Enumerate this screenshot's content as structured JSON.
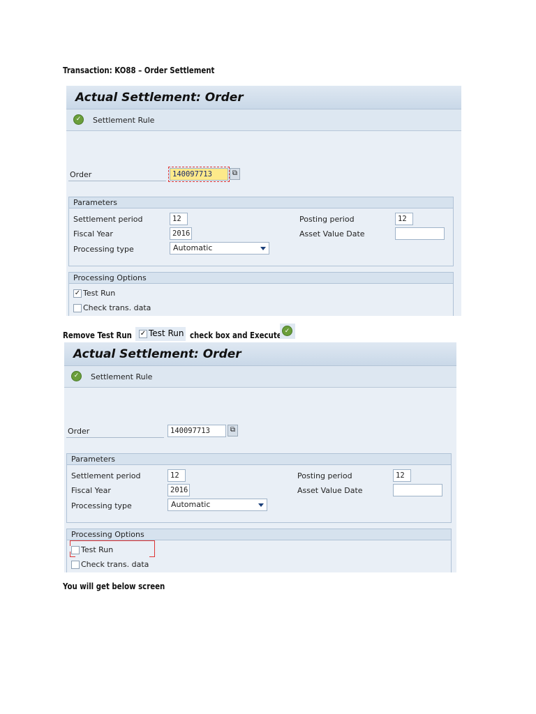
{
  "doc": {
    "heading": "Transaction: KO88 – Order Settlement",
    "instruction_pre": "Remove Test Run",
    "instruction_checkbox": "Test Run",
    "instruction_post": "check box and Execute",
    "footer": "You will get below screen"
  },
  "panels": [
    {
      "title": "Actual Settlement: Order",
      "toolbar_button": "Settlement Rule",
      "order_label": "Order",
      "order_value": "140097713",
      "parameters": {
        "header": "Parameters",
        "settlement_period_label": "Settlement period",
        "settlement_period": "12",
        "fiscal_year_label": "Fiscal Year",
        "fiscal_year": "2016",
        "processing_type_label": "Processing type",
        "processing_type": "Automatic",
        "posting_period_label": "Posting period",
        "posting_period": "12",
        "asset_value_date_label": "Asset Value Date",
        "asset_value_date": ""
      },
      "options": {
        "header": "Processing Options",
        "test_run_label": "Test Run",
        "test_run_checked": true,
        "check_trans_label": "Check trans. data",
        "check_trans_checked": false
      }
    },
    {
      "title": "Actual Settlement: Order",
      "toolbar_button": "Settlement Rule",
      "order_label": "Order",
      "order_value": "140097713",
      "parameters": {
        "header": "Parameters",
        "settlement_period_label": "Settlement period",
        "settlement_period": "12",
        "fiscal_year_label": "Fiscal Year",
        "fiscal_year": "2016",
        "processing_type_label": "Processing type",
        "processing_type": "Automatic",
        "posting_period_label": "Posting period",
        "posting_period": "12",
        "asset_value_date_label": "Asset Value Date",
        "asset_value_date": ""
      },
      "options": {
        "header": "Processing Options",
        "test_run_label": "Test Run",
        "test_run_checked": false,
        "check_trans_label": "Check trans. data",
        "check_trans_checked": false
      }
    }
  ]
}
